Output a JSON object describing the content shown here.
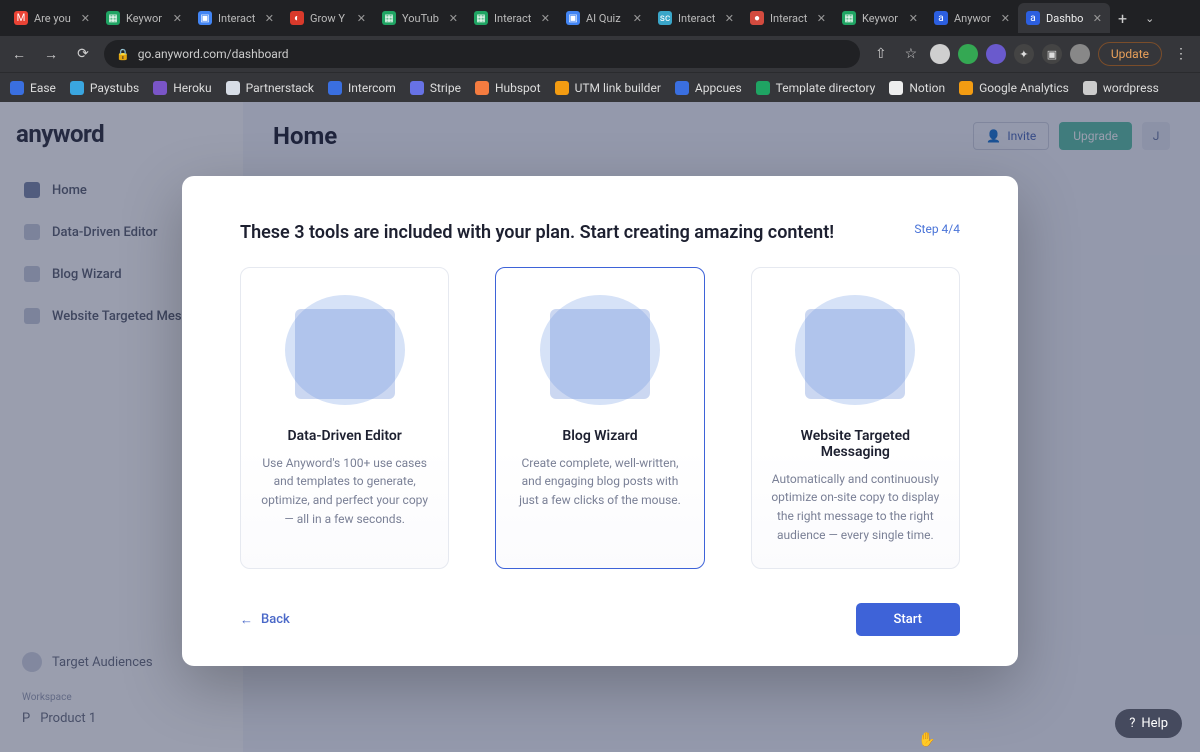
{
  "browser": {
    "tabs": [
      {
        "label": "Are you",
        "favicon_bg": "#ea4335",
        "favicon_txt": "M"
      },
      {
        "label": "Keywor",
        "favicon_bg": "#1fa463",
        "favicon_txt": "▦"
      },
      {
        "label": "Interact",
        "favicon_bg": "#4285f4",
        "favicon_txt": "▣"
      },
      {
        "label": "Grow Y",
        "favicon_bg": "#d93a2b",
        "favicon_txt": "◐"
      },
      {
        "label": "YouTub",
        "favicon_bg": "#1fa463",
        "favicon_txt": "▦"
      },
      {
        "label": "Interact",
        "favicon_bg": "#1fa463",
        "favicon_txt": "▦"
      },
      {
        "label": "AI Quiz",
        "favicon_bg": "#4285f4",
        "favicon_txt": "▣"
      },
      {
        "label": "Interact",
        "favicon_bg": "#3aa6c9",
        "favicon_txt": "sc"
      },
      {
        "label": "Interact",
        "favicon_bg": "#d34b3f",
        "favicon_txt": "●"
      },
      {
        "label": "Keywor",
        "favicon_bg": "#1fa463",
        "favicon_txt": "▦"
      },
      {
        "label": "Anywor",
        "favicon_bg": "#2c5fe0",
        "favicon_txt": "a"
      },
      {
        "label": "Dashbo",
        "favicon_bg": "#2c5fe0",
        "favicon_txt": "a",
        "active": true
      }
    ],
    "url": "go.anyword.com/dashboard",
    "update_label": "Update",
    "bookmarks": [
      {
        "label": "Ease",
        "bg": "#3a6fe0"
      },
      {
        "label": "Paystubs",
        "bg": "#3aa6e0"
      },
      {
        "label": "Heroku",
        "bg": "#7a55c7"
      },
      {
        "label": "Partnerstack",
        "bg": "#d7dde6"
      },
      {
        "label": "Intercom",
        "bg": "#3a6fe0"
      },
      {
        "label": "Stripe",
        "bg": "#6772e5"
      },
      {
        "label": "Hubspot",
        "bg": "#f57c40"
      },
      {
        "label": "UTM link builder",
        "bg": "#f39c12"
      },
      {
        "label": "Appcues",
        "bg": "#3a6fe0"
      },
      {
        "label": "Template directory",
        "bg": "#1fa463"
      },
      {
        "label": "Notion",
        "bg": "#eeeeee"
      },
      {
        "label": "Google Analytics",
        "bg": "#f39c12"
      },
      {
        "label": "wordpress",
        "bg": "#cccccc"
      }
    ],
    "nav_icons": [
      {
        "name": "profile-1",
        "bg": "#cfcfcf"
      },
      {
        "name": "profile-2",
        "bg": "#34a853"
      },
      {
        "name": "profile-3",
        "bg": "#6a5acd"
      },
      {
        "name": "extensions-icon",
        "bg": "#444",
        "txt": "✦"
      },
      {
        "name": "panel-icon",
        "bg": "#444",
        "txt": "▣"
      },
      {
        "name": "profile-avatar",
        "bg": "#888"
      }
    ]
  },
  "app": {
    "logo": "anyword",
    "sidebar": {
      "items": [
        {
          "label": "Home",
          "active": true
        },
        {
          "label": "Data-Driven Editor"
        },
        {
          "label": "Blog Wizard"
        },
        {
          "label": "Website Targeted Mess"
        }
      ],
      "target_audiences": "Target Audiences",
      "workspace_label": "Workspace",
      "product": {
        "letter": "P",
        "name": "Product 1"
      }
    },
    "header": {
      "title": "Home",
      "invite": "Invite",
      "upgrade": "Upgrade",
      "avatar_letter": "J"
    }
  },
  "modal": {
    "title": "These 3 tools are included with your plan. Start creating amazing content!",
    "step": "Step 4/4",
    "cards": [
      {
        "title": "Data-Driven Editor",
        "desc": "Use Anyword's 100+ use cases and templates to generate, optimize, and perfect your copy — all in a few seconds.",
        "selected": false
      },
      {
        "title": "Blog Wizard",
        "desc": "Create complete, well-written, and engaging blog posts with just a few clicks of the mouse.",
        "selected": true
      },
      {
        "title": "Website Targeted Messaging",
        "desc": "Automatically and continuously optimize on-site copy to display the right message to the right audience — every single time.",
        "selected": false
      }
    ],
    "back": "Back",
    "start": "Start"
  },
  "help": "Help"
}
